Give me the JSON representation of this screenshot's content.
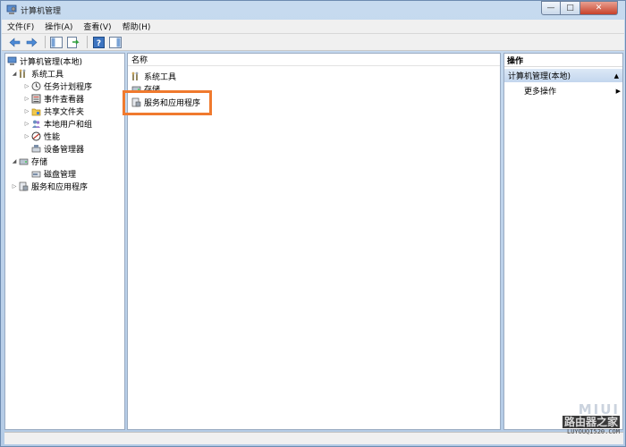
{
  "window": {
    "title": "计算机管理",
    "buttons": {
      "minimize": "—",
      "maximize": "□",
      "close": "✕"
    }
  },
  "menu": [
    "文件(F)",
    "操作(A)",
    "查看(V)",
    "帮助(H)"
  ],
  "toolbar": {
    "icons": [
      "back-arrow-icon",
      "forward-arrow-icon",
      "console-tree-icon",
      "export-icon",
      "help-icon",
      "show-pane-icon"
    ]
  },
  "tree": {
    "root": "计算机管理(本地)",
    "items": [
      {
        "label": "系统工具",
        "expanded": true
      },
      {
        "label": "任务计划程序"
      },
      {
        "label": "事件查看器"
      },
      {
        "label": "共享文件夹"
      },
      {
        "label": "本地用户和组"
      },
      {
        "label": "性能"
      },
      {
        "label": "设备管理器"
      },
      {
        "label": "存储",
        "expanded": true
      },
      {
        "label": "磁盘管理"
      },
      {
        "label": "服务和应用程序"
      }
    ]
  },
  "center": {
    "column_header": "名称",
    "rows": [
      "系统工具",
      "存储",
      "服务和应用程序"
    ]
  },
  "actions": {
    "header": "操作",
    "section": "计算机管理(本地)",
    "item": "更多操作"
  },
  "watermark": {
    "top": "MIUI",
    "middle": "路由器之家",
    "bottom": "LUYOUQI520.COM"
  },
  "colors": {
    "highlight": "#f07a2e",
    "selection": "#c3d6ee"
  }
}
